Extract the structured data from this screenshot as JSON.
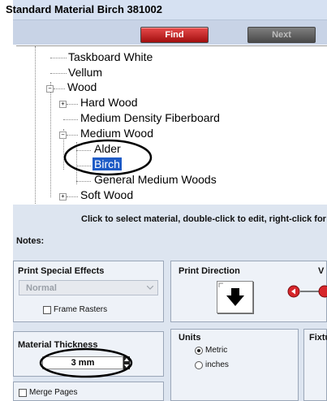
{
  "window": {
    "title": "Standard Material Birch 381002"
  },
  "toolbar": {
    "find_label": "Find",
    "next_label": "Next"
  },
  "tree": {
    "items": [
      {
        "label": "Taskboard White"
      },
      {
        "label": "Vellum"
      },
      {
        "label": "Wood"
      },
      {
        "label": "Hard Wood"
      },
      {
        "label": "Medium Density Fiberboard"
      },
      {
        "label": "Medium Wood"
      },
      {
        "label": "Alder"
      },
      {
        "label": "Birch"
      },
      {
        "label": "General Medium Woods"
      },
      {
        "label": "Soft Wood"
      }
    ],
    "selected": "Birch"
  },
  "hint": "Click to select material, double-click to edit, right-click for ot",
  "notes_label": "Notes:",
  "print_special_effects": {
    "title": "Print Special Effects",
    "value": "Normal",
    "frame_rasters_label": "Frame Rasters"
  },
  "print_direction": {
    "title": "Print Direction"
  },
  "partial_title": "V",
  "material_thickness": {
    "title": "Material Thickness",
    "value": "3 mm"
  },
  "units": {
    "title": "Units",
    "metric_label": "Metric",
    "inches_label": "inches",
    "selected": "Metric"
  },
  "fixture": {
    "title": "Fixtu"
  },
  "merge_pages_label": "Merge Pages",
  "colors": {
    "accent_red": "#cc1f1f",
    "selection": "#1e5bc6",
    "annotation": "#000000"
  }
}
